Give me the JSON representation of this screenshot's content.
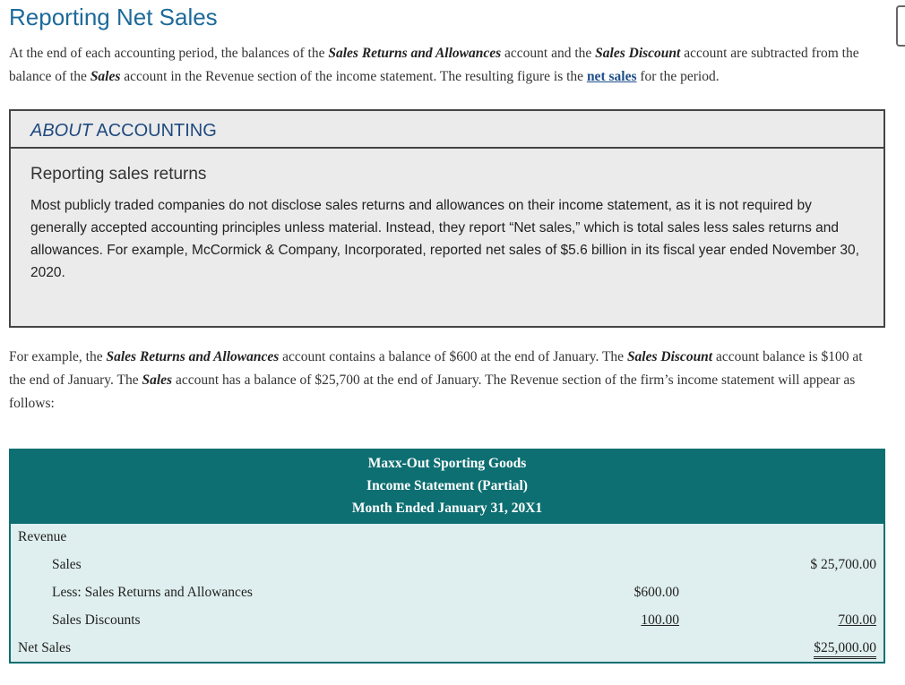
{
  "page": {
    "title": "Reporting Net Sales",
    "p1": {
      "t1": "At the end of each accounting period, the balances of the ",
      "b1": "Sales Returns and Allowances",
      "t2": " account and the ",
      "b2": "Sales Discount",
      "t3": " account are subtracted from the balance of the ",
      "b3": "Sales",
      "t4": " account in the Revenue section of the income statement. The resulting figure is the ",
      "link": "net sales",
      "t5": " for the period."
    },
    "p2": {
      "t1": "For example, the ",
      "b1": "Sales Returns and Allowances",
      "t2": " account contains a balance of $600 at the end of January. The ",
      "b2": "Sales Discount",
      "t3": " account balance is $100 at the end of January. The ",
      "b3": "Sales",
      "t4": " account has a balance of $25,700 at the end of January. The Revenue section of the firm’s income statement will appear as follows:"
    }
  },
  "about": {
    "label_italic": "ABOUT",
    "label_rest": " ACCOUNTING",
    "subtitle": "Reporting sales returns",
    "body": "Most publicly traded companies do not disclose sales returns and allowances on their income statement, as it is not required by generally accepted accounting principles unless material. Instead, they report “Net sales,” which is total sales less sales returns and allowances. For example, McCormick & Company, Incorporated, reported net sales of $5.6 billion in its fiscal year ended November 30, 2020."
  },
  "statement": {
    "company": "Maxx-Out Sporting Goods",
    "name": "Income Statement (Partial)",
    "period": "Month Ended January 31, 20X1",
    "revenue_label": "Revenue",
    "sales_label": "Sales",
    "sales_amount": "$ 25,700.00",
    "returns_label": "Less: Sales Returns and Allowances",
    "returns_amount": "$600.00",
    "discounts_label": "Sales Discounts",
    "discounts_amount": "100.00",
    "deductions_total": "700.00",
    "net_label": "Net Sales",
    "net_amount": "$25,000.00"
  }
}
